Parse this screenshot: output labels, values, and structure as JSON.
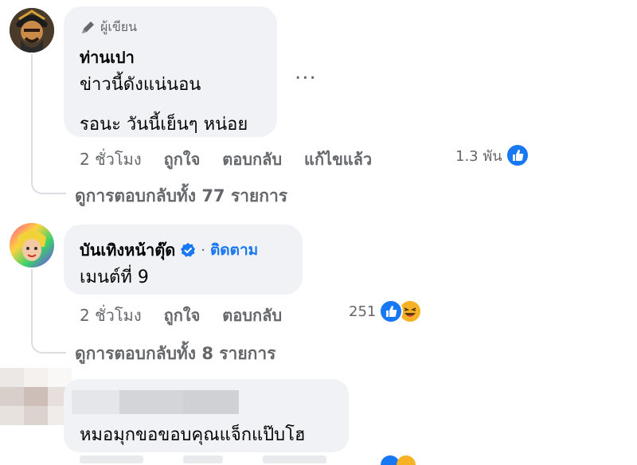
{
  "comments": [
    {
      "author_badge": "ผู้เขียน",
      "author": "ท่านเปา",
      "lines": [
        "ข่าวนี้ดังแน่นอน",
        "รอนะ วันนี้เย็นๆ หน่อย"
      ],
      "time": "2 ชั่วโมง",
      "like": "ถูกใจ",
      "reply": "ตอบกลับ",
      "edited": "แก้ไขแล้ว",
      "reaction_count": "1.3 พัน",
      "replies_link": "ดูการตอบกลับทั้ง 77 รายการ",
      "more": "..."
    },
    {
      "author": "บันเทิงหน้าตุ๊ด",
      "separator": "·",
      "follow": "ติดตาม",
      "lines": [
        "เมนต์ที่ 9"
      ],
      "time": "2 ชั่วโมง",
      "like": "ถูกใจ",
      "reply": "ตอบกลับ",
      "reaction_count": "251",
      "replies_link": "ดูการตอบกลับทั้ง 8 รายการ"
    },
    {
      "lines": [
        "หมอมุกขอขอบคุณแจ็กแป๊บโฮ"
      ]
    }
  ],
  "colors": {
    "like_blue": "#1877f2",
    "haha_yellow": "#f7b125",
    "bubble_gray": "#f0f2f5",
    "meta_gray": "#65676b"
  }
}
